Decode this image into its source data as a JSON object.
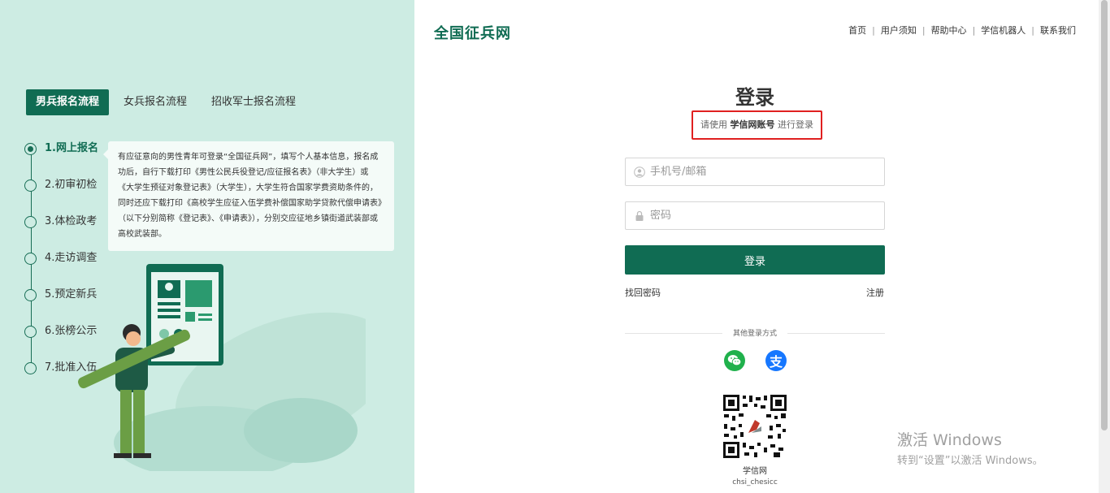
{
  "left": {
    "tabs": [
      {
        "label": "男兵报名流程",
        "active": true
      },
      {
        "label": "女兵报名流程",
        "active": false
      },
      {
        "label": "招收军士报名流程",
        "active": false
      }
    ],
    "steps": [
      {
        "label": "1.网上报名",
        "active": true
      },
      {
        "label": "2.初审初检",
        "active": false
      },
      {
        "label": "3.体检政考",
        "active": false
      },
      {
        "label": "4.走访调查",
        "active": false
      },
      {
        "label": "5.预定新兵",
        "active": false
      },
      {
        "label": "6.张榜公示",
        "active": false
      },
      {
        "label": "7.批准入伍",
        "active": false
      }
    ],
    "info_text": "有应征意向的男性青年可登录“全国征兵网”，填写个人基本信息，报名成功后，自行下载打印《男性公民兵役登记/应征报名表》（非大学生）或《大学生预征对象登记表》（大学生），大学生符合国家学费资助条件的，同时还应下载打印《高校学生应征入伍学费补偿国家助学贷款代偿申请表》（以下分别简称《登记表》、《申请表》），分别交应征地乡镇街道武装部或高校武装部。"
  },
  "header": {
    "logo": "全国征兵网",
    "nav": [
      "首页",
      "用户须知",
      "帮助中心",
      "学信机器人",
      "联系我们"
    ]
  },
  "login": {
    "title": "登录",
    "subtitle_pre": "请使用",
    "subtitle_account": "学信网账号",
    "subtitle_post": "进行登录",
    "username_placeholder": "手机号/邮箱",
    "password_placeholder": "密码",
    "submit_label": "登录",
    "forgot_label": "找回密码",
    "register_label": "注册",
    "other_methods_label": "其他登录方式",
    "qr_label": "学信网",
    "qr_id": "chsi_chesicc",
    "alipay_glyph": "支"
  },
  "watermark": {
    "line1": "激活 Windows",
    "line2": "转到“设置”以激活 Windows。"
  },
  "colors": {
    "primary": "#106c53",
    "left_bg": "#cdece3",
    "highlight_border": "#e02020",
    "wechat": "#20b14c",
    "alipay": "#1677ff"
  }
}
